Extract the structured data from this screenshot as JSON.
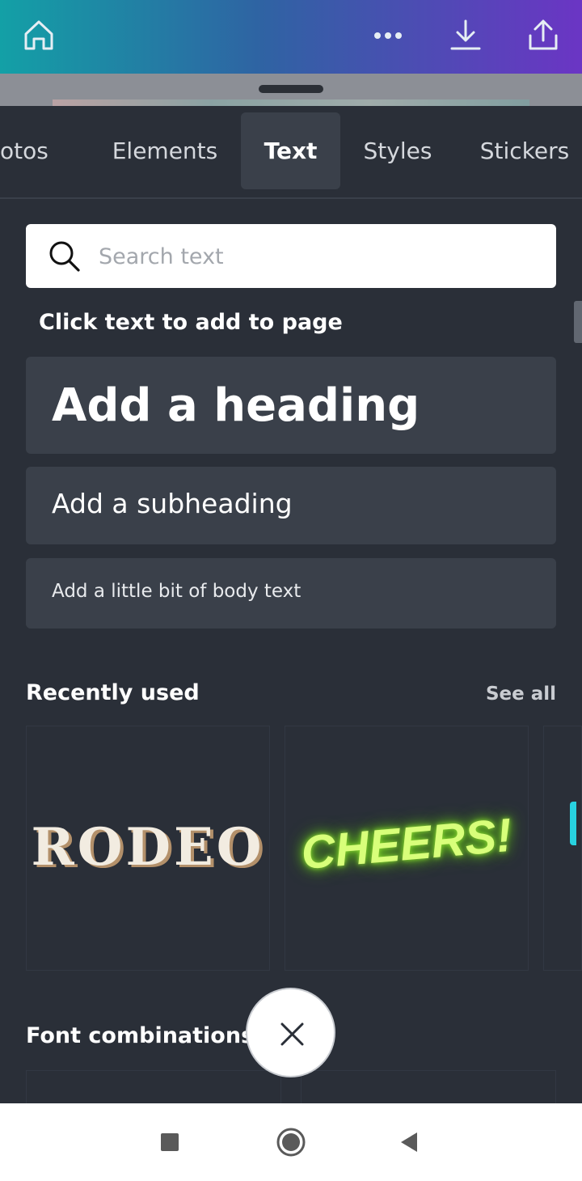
{
  "colors": {
    "panel_bg": "#2a2f38",
    "card_bg": "#3a404a",
    "gradient_start": "#13a0a6",
    "gradient_end": "#6b35c4",
    "glow_green": "#d8ff7a",
    "accent_cyan": "#28d2e0"
  },
  "topbar": {
    "icons": [
      "home-icon",
      "more-icon",
      "download-icon",
      "share-icon"
    ]
  },
  "tabs": [
    {
      "label": "otos",
      "active": false
    },
    {
      "label": "Elements",
      "active": false
    },
    {
      "label": "Text",
      "active": true
    },
    {
      "label": "Styles",
      "active": false
    },
    {
      "label": "Stickers",
      "active": false
    }
  ],
  "search": {
    "placeholder": "Search text",
    "value": ""
  },
  "hint": "Click text to add to page",
  "text_options": {
    "heading": "Add a heading",
    "subheading": "Add a subheading",
    "body": "Add a little bit of body text"
  },
  "recently_used": {
    "title": "Recently used",
    "see_all": "See all",
    "items": [
      "RODEO",
      "CHEERS!"
    ]
  },
  "font_combinations": {
    "title": "Font combinations"
  },
  "navbar": {
    "icons": [
      "recent-apps-icon",
      "home-circle-icon",
      "back-icon"
    ]
  }
}
